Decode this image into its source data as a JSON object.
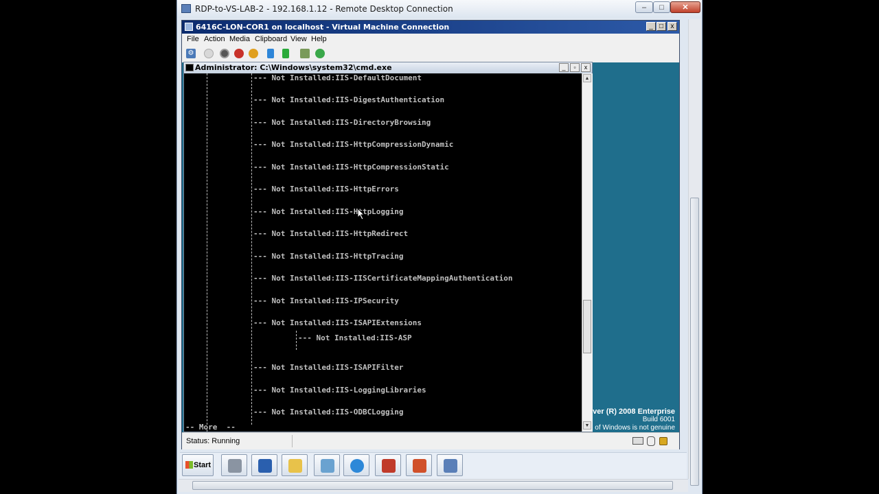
{
  "rdp": {
    "title": "RDP-to-VS-LAB-2 - 192.168.1.12 - Remote Desktop Connection",
    "buttons": {
      "minimize": "–",
      "maximize": "□",
      "close": "✕"
    }
  },
  "vm": {
    "title": "6416C-LON-COR1 on localhost - Virtual Machine Connection",
    "menu": [
      "File",
      "Action",
      "Media",
      "Clipboard",
      "View",
      "Help"
    ],
    "status": "Status: Running",
    "brand": {
      "line1": "ver (R) 2008 Enterprise",
      "line2": "Build 6001",
      "line3": "of Windows is not genuine"
    }
  },
  "cmd": {
    "title": "Administrator: C:\\Windows\\system32\\cmd.exe",
    "lines": [
      "--- Not Installed:IIS-DefaultDocument",
      "--- Not Installed:IIS-DigestAuthentication",
      "--- Not Installed:IIS-DirectoryBrowsing",
      "--- Not Installed:IIS-HttpCompressionDynamic",
      "--- Not Installed:IIS-HttpCompressionStatic",
      "--- Not Installed:IIS-HttpErrors",
      "--- Not Installed:IIS-HttpLogging",
      "--- Not Installed:IIS-HttpRedirect",
      "--- Not Installed:IIS-HttpTracing",
      "--- Not Installed:IIS-IISCertificateMappingAuthentication",
      "--- Not Installed:IIS-IPSecurity",
      "--- Not Installed:IIS-ISAPIExtensions"
    ],
    "sub_line": "--- Not Installed:IIS-ASP",
    "lines_after": [
      "--- Not Installed:IIS-ISAPIFilter",
      "--- Not Installed:IIS-LoggingLibraries",
      "--- Not Installed:IIS-ODBCLogging"
    ],
    "more": "-- More  --"
  },
  "taskbar": {
    "start": "Start",
    "icons": [
      "server-manager-icon",
      "powershell-icon",
      "explorer-icon",
      "network-icon",
      "ie-icon",
      "toolbox-icon",
      "powerpoint-icon",
      "remote-desktop-icon"
    ]
  }
}
